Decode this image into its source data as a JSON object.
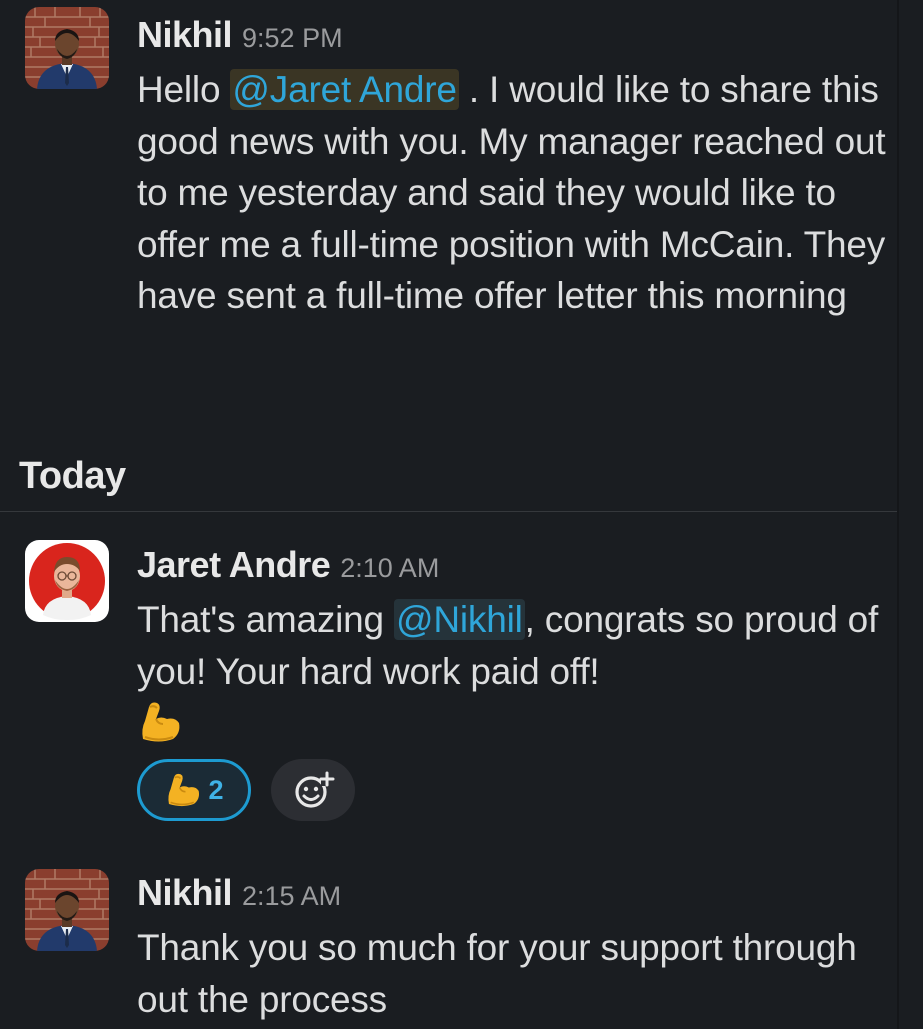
{
  "messages": [
    {
      "author": "Nikhil",
      "time": "9:52 PM",
      "text_before": "Hello ",
      "mention": "@Jaret Andre",
      "text_after": " . I would like to share this good news with you. My manager reached out to me yesterday and said they would like to offer me a full-time position with McCain. They have sent a full-time offer letter this morning",
      "avatar": "profile-photo-brick-wall"
    },
    {
      "author": "Jaret Andre",
      "time": "2:10 AM",
      "text_before": "That's amazing ",
      "mention": "@Nikhil",
      "text_after": ", congrats so proud of you! Your hard work paid off!",
      "emoji": "flexed-biceps",
      "avatar": "profile-photo-red-background",
      "reactions": [
        {
          "emoji": "flexed-biceps",
          "count": "2"
        }
      ]
    },
    {
      "author": "Nikhil",
      "time": "2:15 AM",
      "text": "Thank you so much for your support through out the process",
      "avatar": "profile-photo-brick-wall"
    }
  ],
  "day_divider": "Today",
  "add_reaction_icon": "add-reaction-icon",
  "colors": {
    "background": "#1a1d21",
    "mention_text": "#2fa6d9",
    "reaction_border": "#1d9bd1",
    "timestamp": "#9a9b9d"
  }
}
